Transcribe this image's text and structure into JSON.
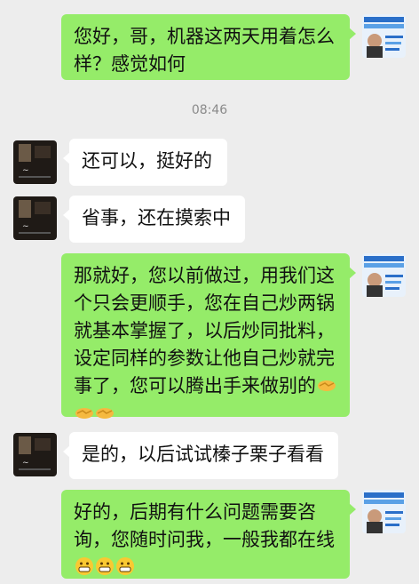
{
  "conversation": {
    "timestamp": "08:46",
    "messages": [
      {
        "from": "me",
        "text": "您好，哥，机器这两天用着怎么样？感觉如何",
        "emoji": []
      },
      {
        "from": "contact",
        "text": "还可以，挺好的",
        "emoji": []
      },
      {
        "from": "contact",
        "text": "省事，还在摸索中",
        "emoji": []
      },
      {
        "from": "me",
        "text": "那就好，您以前做过，用我们这个只会更顺手，您在自己炒两锅就基本掌握了，以后炒同批料，设定同样的参数让他自己炒就完事了，您可以腾出手来做别的",
        "emoji": [
          "handshake-emoji",
          "handshake-emoji",
          "handshake-emoji"
        ]
      },
      {
        "from": "contact",
        "text": "是的，以后试试榛子栗子看看",
        "emoji": []
      },
      {
        "from": "me",
        "text": "好的，后期有什么问题需要咨询，您随时问我，一般我都在线",
        "emoji": [
          "grinning-face-emoji",
          "grinning-face-emoji",
          "grinning-face-emoji"
        ]
      }
    ]
  },
  "colors": {
    "background": "#ededed",
    "sent_bubble": "#95ec69",
    "received_bubble": "#ffffff"
  }
}
